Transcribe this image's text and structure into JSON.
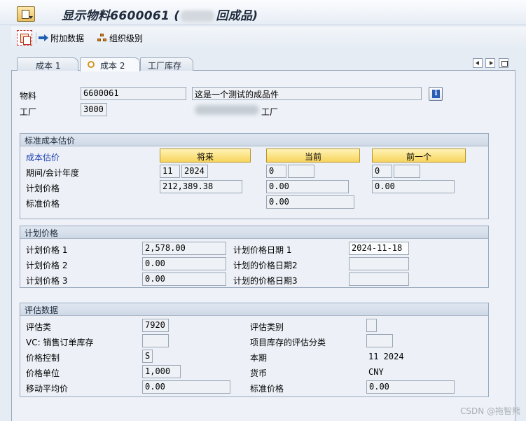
{
  "title": {
    "prefix": "显示物料6600061 (",
    "suffix": "回成品)"
  },
  "toolbar": {
    "additional_data": "附加数据",
    "org_levels": "组织级别"
  },
  "tabs": [
    "成本 1",
    "成本 2",
    "工厂库存"
  ],
  "header": {
    "material_label": "物料",
    "material_value": "6600061",
    "material_desc": "这是一个测试的成品件",
    "plant_label": "工厂",
    "plant_value": "3000",
    "plant_name_suffix": "工厂",
    "info": "i"
  },
  "std_cost": {
    "title": "标准成本估价",
    "cost_estimate_label": "成本估价",
    "btn_future": "将来",
    "btn_current": "当前",
    "btn_previous": "前一个",
    "period_label": "期间/会计年度",
    "future_period": "11",
    "future_year": "2024",
    "current_period": "0",
    "current_year": "",
    "previous_period": "0",
    "previous_year": "",
    "planned_price_label": "计划价格",
    "future_planned": "212,389.38",
    "current_planned": "0.00",
    "previous_planned": "0.00",
    "standard_price_label": "标准价格",
    "standard_price": "0.00"
  },
  "planned": {
    "title": "计划价格",
    "p1_label": "计划价格 1",
    "p1": "2,578.00",
    "p2_label": "计划价格 2",
    "p2": "0.00",
    "p3_label": "计划价格 3",
    "p3": "0.00",
    "d1_label": "计划价格日期 1",
    "d1": "2024-11-18",
    "d2_label": "计划的价格日期2",
    "d2": "",
    "d3_label": "计划的价格日期3",
    "d3": ""
  },
  "valuation": {
    "title": "评估数据",
    "class_label": "评估类",
    "class_value": "7920",
    "vc_label": "VC: 销售订单库存",
    "vc_value": "",
    "price_control_label": "价格控制",
    "price_control_value": "S",
    "price_unit_label": "价格单位",
    "price_unit_value": "1,000",
    "map_label": "移动平均价",
    "map_value": "0.00",
    "category_label": "评估类别",
    "category_value": "",
    "project_label": "项目库存的评估分类",
    "project_value": "",
    "period_label": "本期",
    "period_value": "11  2024",
    "currency_label": "货币",
    "currency_value": "CNY",
    "std_price_label": "标准价格",
    "std_price_value": "0.00"
  },
  "watermark": "CSDN @拖智熊"
}
